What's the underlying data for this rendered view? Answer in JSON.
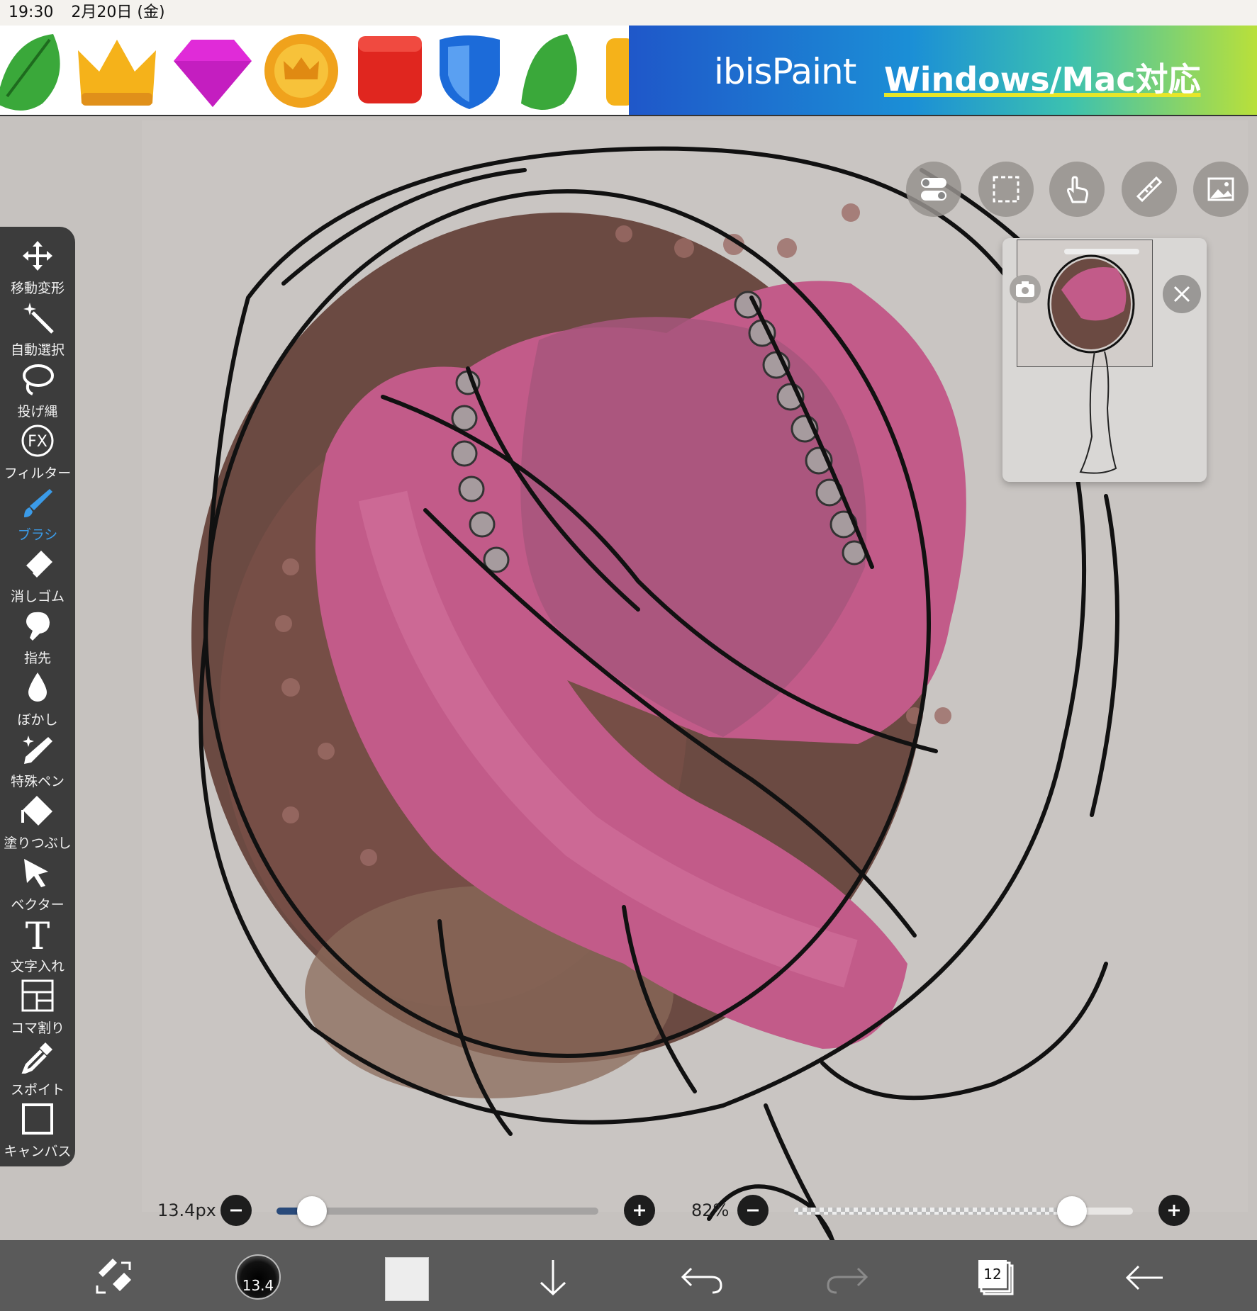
{
  "status": {
    "time": "19:30",
    "date": "2月20日 (金)"
  },
  "ad": {
    "logo": "ibisPaint",
    "tagline": "Windows/Mac対応",
    "icons": [
      "leaf-icon",
      "crown-icon",
      "gem-icon",
      "coin-icon",
      "red-box-icon",
      "shield-icon",
      "leaf-icon"
    ]
  },
  "toolbar": {
    "items": [
      {
        "label": "移動変形",
        "icon": "move-icon"
      },
      {
        "label": "自動選択",
        "icon": "magic-wand-icon"
      },
      {
        "label": "投げ縄",
        "icon": "lasso-icon"
      },
      {
        "label": "フィルター",
        "icon": "fx-icon"
      },
      {
        "label": "ブラシ",
        "icon": "brush-icon",
        "active": true
      },
      {
        "label": "消しゴム",
        "icon": "eraser-icon"
      },
      {
        "label": "指先",
        "icon": "smudge-icon"
      },
      {
        "label": "ぼかし",
        "icon": "blur-icon"
      },
      {
        "label": "特殊ペン",
        "icon": "special-pen-icon"
      },
      {
        "label": "塗りつぶし",
        "icon": "bucket-icon"
      },
      {
        "label": "ベクター",
        "icon": "vector-icon"
      },
      {
        "label": "文字入れ",
        "icon": "text-icon"
      },
      {
        "label": "コマ割り",
        "icon": "frame-divider-icon"
      },
      {
        "label": "スポイト",
        "icon": "eyedropper-icon"
      },
      {
        "label": "キャンバス",
        "icon": "canvas-icon"
      }
    ],
    "fx_text": "FX",
    "text_glyph": "T"
  },
  "top_tools": [
    "toggle-icon",
    "selection-icon",
    "hand-icon",
    "ruler-icon",
    "image-icon"
  ],
  "sliders": {
    "brush_size": {
      "label": "13.4px",
      "value_fraction": 0.11
    },
    "opacity": {
      "label": "82%",
      "value_fraction": 0.82
    }
  },
  "bottom": {
    "brush_size_badge": "13.4",
    "layer_count": "12",
    "primary_color": "#ededed"
  },
  "colors": {
    "toolbar_bg": "#3c3c3c",
    "active": "#3b9be8",
    "canvas_bg": "#c6c2bf",
    "hair": "#c25b89",
    "bg_brown": "#6b4a42"
  }
}
